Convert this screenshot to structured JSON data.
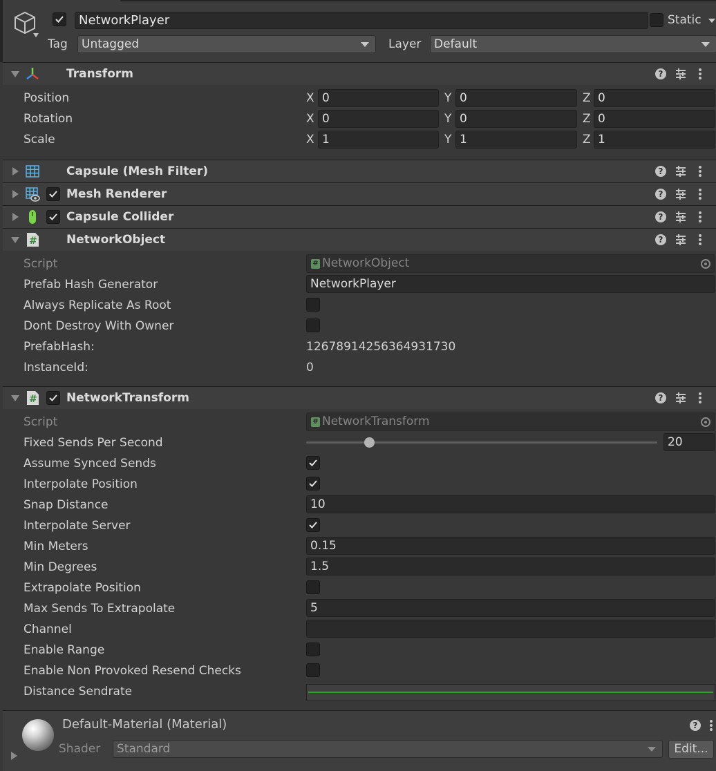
{
  "header": {
    "object_name": "NetworkPlayer",
    "static_label": "Static",
    "tag_label": "Tag",
    "tag_value": "Untagged",
    "layer_label": "Layer",
    "layer_value": "Default"
  },
  "transform": {
    "title": "Transform",
    "rows": [
      {
        "label": "Position",
        "x": "0",
        "y": "0",
        "z": "0"
      },
      {
        "label": "Rotation",
        "x": "0",
        "y": "0",
        "z": "0"
      },
      {
        "label": "Scale",
        "x": "1",
        "y": "1",
        "z": "1"
      }
    ],
    "axis_x": "X",
    "axis_y": "Y",
    "axis_z": "Z"
  },
  "components": {
    "mesh_filter": "Capsule (Mesh Filter)",
    "mesh_renderer": "Mesh Renderer",
    "capsule_collider": "Capsule Collider"
  },
  "network_object": {
    "title": "NetworkObject",
    "script_label": "Script",
    "script_value": "NetworkObject",
    "prefab_hash_generator_label": "Prefab Hash Generator",
    "prefab_hash_generator_value": "NetworkPlayer",
    "always_replicate_label": "Always Replicate As Root",
    "always_replicate": false,
    "dont_destroy_label": "Dont Destroy With Owner",
    "dont_destroy": false,
    "prefab_hash_label": "PrefabHash:",
    "prefab_hash_value": "12678914256364931730",
    "instance_id_label": "InstanceId:",
    "instance_id_value": "0"
  },
  "network_transform": {
    "title": "NetworkTransform",
    "script_label": "Script",
    "script_value": "NetworkTransform",
    "fixed_sends_label": "Fixed Sends Per Second",
    "fixed_sends_value": "20",
    "fixed_sends_slider_fraction": 0.18,
    "assume_synced_label": "Assume Synced Sends",
    "assume_synced": true,
    "interpolate_position_label": "Interpolate Position",
    "interpolate_position": true,
    "snap_distance_label": "Snap Distance",
    "snap_distance_value": "10",
    "interpolate_server_label": "Interpolate Server",
    "interpolate_server": true,
    "min_meters_label": "Min Meters",
    "min_meters_value": "0.15",
    "min_degrees_label": "Min Degrees",
    "min_degrees_value": "1.5",
    "extrapolate_position_label": "Extrapolate Position",
    "extrapolate_position": false,
    "max_sends_label": "Max Sends To Extrapolate",
    "max_sends_value": "5",
    "channel_label": "Channel",
    "channel_value": "",
    "enable_range_label": "Enable Range",
    "enable_range": false,
    "enable_non_provoked_label": "Enable Non Provoked Resend Checks",
    "enable_non_provoked": false,
    "distance_sendrate_label": "Distance Sendrate",
    "curve_color": "#2aa02a"
  },
  "material": {
    "title": "Default-Material (Material)",
    "shader_label": "Shader",
    "shader_value": "Standard",
    "edit_label": "Edit..."
  },
  "icons": {
    "gameobject": "cube-icon",
    "transform": "transform-axes-icon",
    "mesh_filter": "mesh-grid-icon",
    "mesh_renderer": "mesh-renderer-icon",
    "collider": "capsule-icon",
    "script": "script-hash-icon",
    "help": "help-icon",
    "presets": "presets-icon",
    "more": "kebab-menu-icon"
  }
}
